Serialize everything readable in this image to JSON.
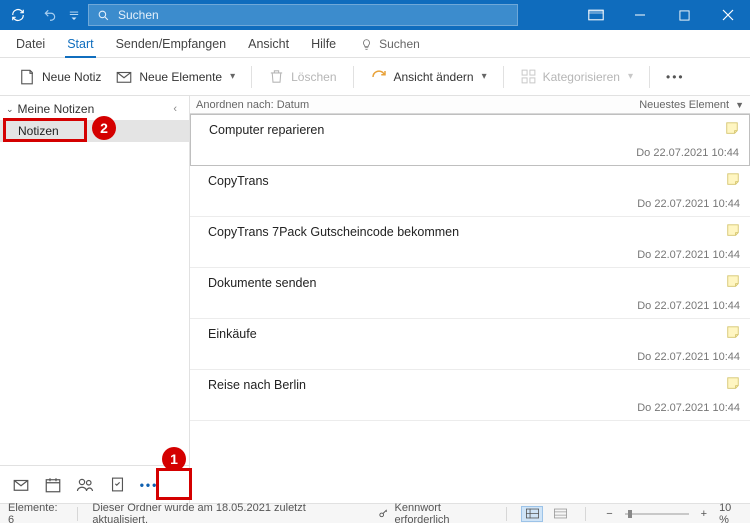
{
  "titlebar": {
    "search_placeholder": "Suchen"
  },
  "menu": {
    "file": "Datei",
    "start": "Start",
    "sendrecv": "Senden/Empfangen",
    "view": "Ansicht",
    "help": "Hilfe",
    "search": "Suchen"
  },
  "ribbon": {
    "new_note": "Neue Notiz",
    "new_items": "Neue Elemente",
    "delete": "Löschen",
    "change_view": "Ansicht ändern",
    "categorize": "Kategorisieren"
  },
  "sidebar": {
    "my_notes": "Meine Notizen",
    "folder": "Notizen"
  },
  "sorter": {
    "arrange_by": "Anordnen nach: Datum",
    "newest": "Neuestes Element"
  },
  "notes": [
    {
      "title": "Computer reparieren",
      "date": "Do 22.07.2021 10:44"
    },
    {
      "title": "CopyTrans",
      "date": "Do 22.07.2021 10:44"
    },
    {
      "title": "CopyTrans 7Pack Gutscheincode bekommen",
      "date": "Do 22.07.2021 10:44"
    },
    {
      "title": "Dokumente senden",
      "date": "Do 22.07.2021 10:44"
    },
    {
      "title": "Einkäufe",
      "date": "Do 22.07.2021 10:44"
    },
    {
      "title": "Reise nach Berlin",
      "date": "Do 22.07.2021 10:44"
    }
  ],
  "status": {
    "elements": "Elemente: 6",
    "updated": "Dieser Ordner wurde am 18.05.2021 zuletzt aktualisiert.",
    "password": "Kennwort erforderlich",
    "zoom": "10 %"
  },
  "annotations": {
    "one": "1",
    "two": "2"
  }
}
